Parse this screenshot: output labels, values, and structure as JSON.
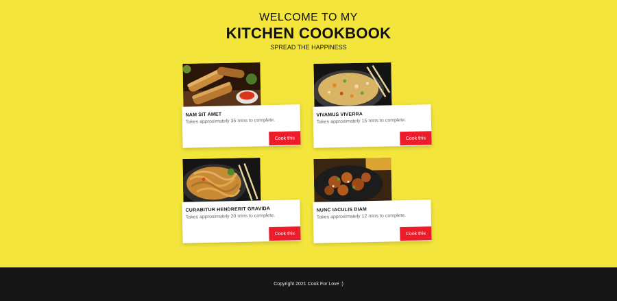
{
  "header": {
    "welcome": "WELCOME TO MY",
    "title": "KITCHEN COOKBOOK",
    "tagline": "SPREAD THE HAPPINESS"
  },
  "recipes": [
    {
      "name": "NAM SIT AMET",
      "description": "Takes approximately 35 mins to complete.",
      "button_label": "Cook this",
      "image": "spring-rolls-photo"
    },
    {
      "name": "VIVAMUS VIVERRA",
      "description": "Takes approximately 15 mins to complete.",
      "button_label": "Cook this",
      "image": "fried-rice-photo"
    },
    {
      "name": "CURABITUR HENDRERIT GRAVIDA",
      "description": "Takes approximately 20 mins to complete.",
      "button_label": "Cook this",
      "image": "noodles-photo"
    },
    {
      "name": "NUNC IACULIS DIAM",
      "description": "Takes approximately 12 mins to complete.",
      "button_label": "Cook this",
      "image": "orange-chicken-photo"
    }
  ],
  "footer": {
    "copyright": "Copyright 2021 Cook For Love :)"
  },
  "colors": {
    "background": "#f3e53b",
    "button": "#ec1c2a",
    "footer": "#161616"
  }
}
